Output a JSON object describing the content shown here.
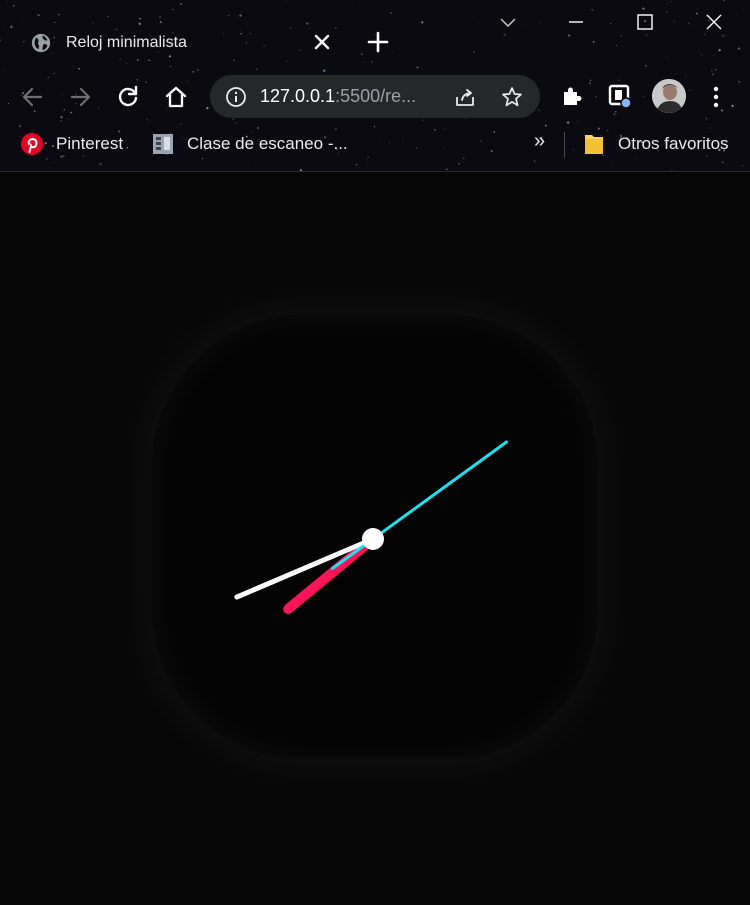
{
  "window": {
    "tab_title": "Reloj minimalista",
    "icons": [
      "globe-icon",
      "close-icon",
      "new-tab-icon",
      "chevron-down-icon",
      "minimize-icon",
      "maximize-icon",
      "window-close-icon"
    ]
  },
  "toolbar": {
    "url_host": "127.0.0.1",
    "url_rest": ":5500/re...",
    "icons": [
      "back-icon",
      "forward-icon",
      "reload-icon",
      "home-icon",
      "info-icon",
      "share-icon",
      "star-icon",
      "puzzle-icon",
      "extension-icon",
      "avatar",
      "more-icon"
    ]
  },
  "bookmarks": {
    "items": [
      {
        "label": "Pinterest",
        "icon": "pinterest-icon"
      },
      {
        "label": "Clase de escaneo -...",
        "icon": "document-icon"
      }
    ],
    "overflow": "»",
    "other": {
      "label": "Otros favoritos",
      "icon": "folder-icon"
    }
  },
  "clock": {
    "hour": 7,
    "minute": 41,
    "second": 9,
    "colors": {
      "hour_hand": "#ff1457",
      "minute_hand": "#ffffff",
      "second_hand": "#1de1ee",
      "center": "#ffffff",
      "face": "#030303"
    }
  }
}
